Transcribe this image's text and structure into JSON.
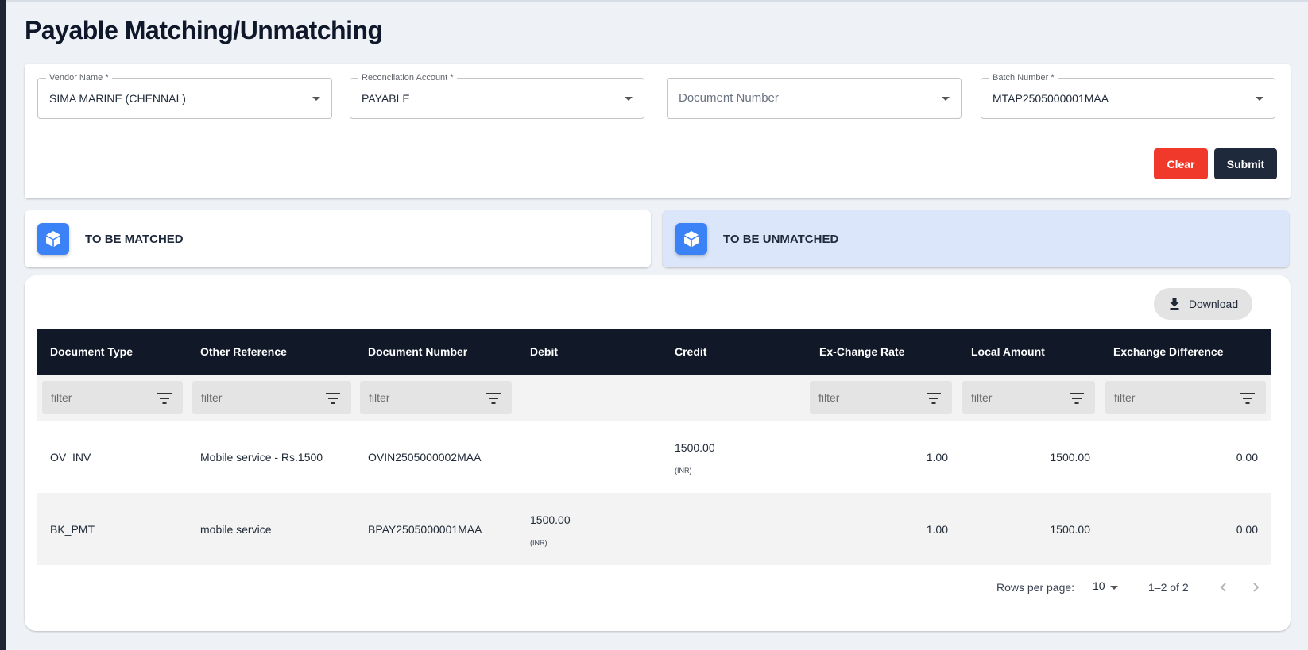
{
  "page": {
    "title": "Payable Matching/Unmatching"
  },
  "filters": {
    "vendor": {
      "label": "Vendor Name *",
      "value": "SIMA MARINE (CHENNAI )"
    },
    "account": {
      "label": "Reconcilation Account *",
      "value": "PAYABLE"
    },
    "document": {
      "placeholder": "Document Number"
    },
    "batch": {
      "label": "Batch Number *",
      "value": "MTAP2505000001MAA"
    }
  },
  "buttons": {
    "clear": "Clear",
    "submit": "Submit",
    "download": "Download"
  },
  "tabs": {
    "matched": "TO BE MATCHED",
    "unmatched": "TO BE UNMATCHED"
  },
  "table": {
    "columns": [
      "Document Type",
      "Other Reference",
      "Document Number",
      "Debit",
      "Credit",
      "Ex-Change Rate",
      "Local Amount",
      "Exchange Difference"
    ],
    "filter_placeholder": "filter",
    "rows": [
      {
        "doc_type": "OV_INV",
        "other_ref": "Mobile service - Rs.1500",
        "doc_number": "OVIN2505000002MAA",
        "debit": "",
        "debit_cur": "",
        "credit": "1500.00",
        "credit_cur": "(INR)",
        "rate": "1.00",
        "local_amount": "1500.00",
        "exchange_diff": "0.00"
      },
      {
        "doc_type": "BK_PMT",
        "other_ref": "mobile service",
        "doc_number": "BPAY2505000001MAA",
        "debit": "1500.00",
        "debit_cur": "(INR)",
        "credit": "",
        "credit_cur": "",
        "rate": "1.00",
        "local_amount": "1500.00",
        "exchange_diff": "0.00"
      }
    ]
  },
  "pagination": {
    "rows_per_page_label": "Rows per page:",
    "rows_per_page": "10",
    "range": "1–2 of 2"
  },
  "colors": {
    "accent": "#3b82f6",
    "clear": "#f0392b",
    "header": "#111827",
    "selected_tab": "#dbe6fb"
  },
  "icons": [
    "cube-icon",
    "download-icon",
    "filter-icon",
    "chevron-left-icon",
    "chevron-right-icon",
    "dropdown-caret-icon"
  ]
}
